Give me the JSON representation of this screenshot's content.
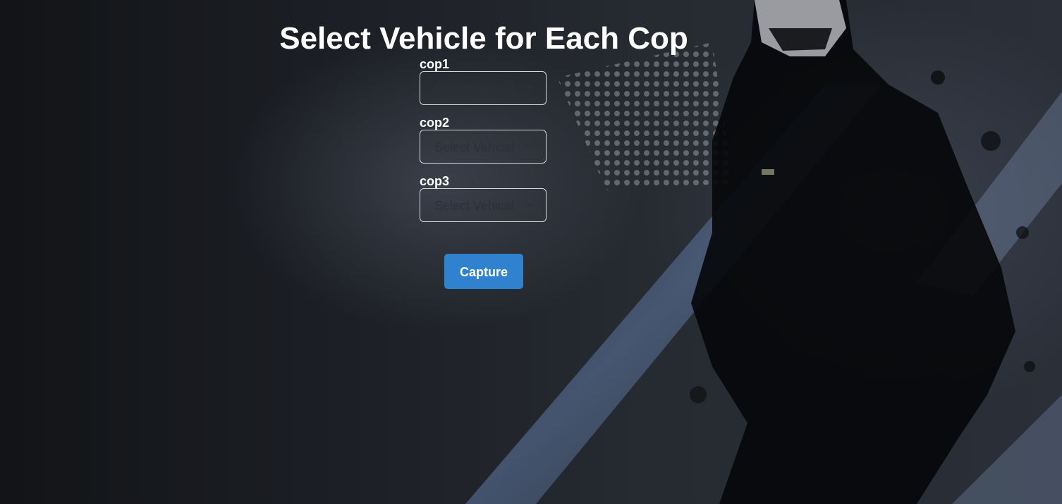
{
  "page": {
    "title": "Select Vehicle for Each Cop"
  },
  "cops": [
    {
      "label": "cop1",
      "select_placeholder": "Select Vehical"
    },
    {
      "label": "cop2",
      "select_placeholder": "Select Vehical"
    },
    {
      "label": "cop3",
      "select_placeholder": "Select Vehical"
    }
  ],
  "actions": {
    "capture_label": "Capture"
  },
  "colors": {
    "button": "#3182ce",
    "text": "#ffffff",
    "select_border": "#d6d9de"
  },
  "icons": {
    "select_caret": "chevron-down-icon"
  }
}
